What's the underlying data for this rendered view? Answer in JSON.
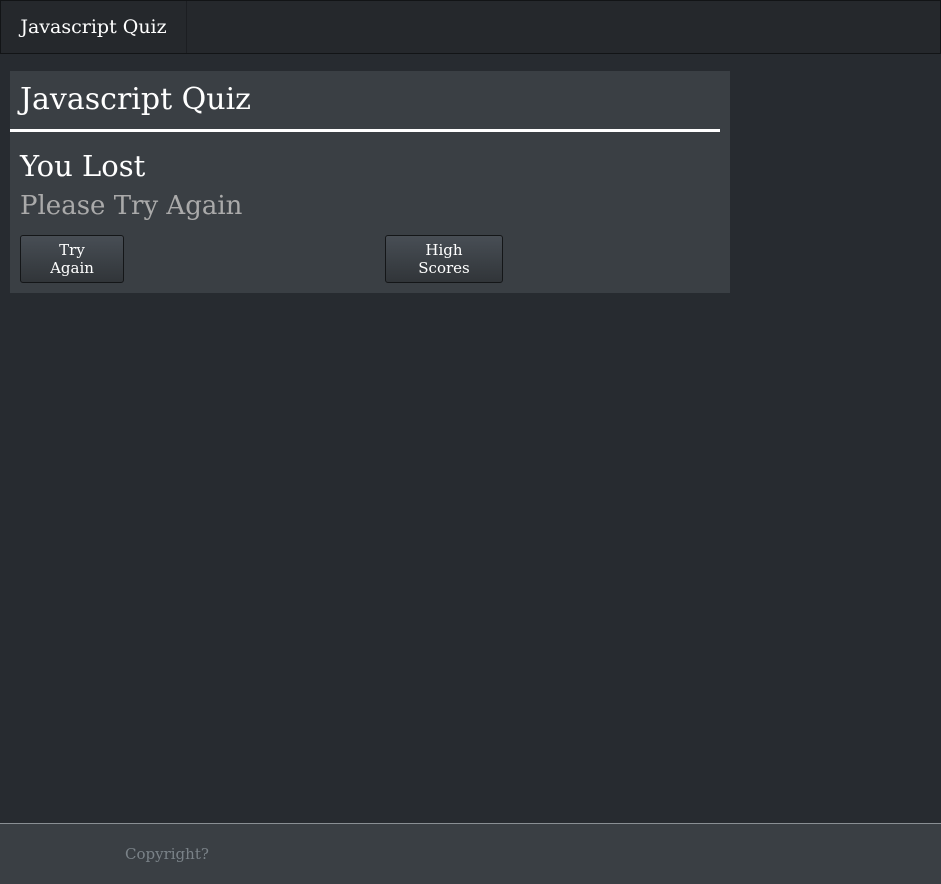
{
  "navbar": {
    "brand": "Javascript Quiz"
  },
  "card": {
    "title": "Javascript Quiz",
    "result_heading": "You Lost",
    "result_subtext": "Please Try Again",
    "buttons": {
      "try_again": "Try Again",
      "high_scores": "High Scores"
    }
  },
  "footer": {
    "text": "Copyright?"
  },
  "colors": {
    "background": "#272b30",
    "navbar": "#25282c",
    "card": "#3a3f44",
    "muted_text": "#aaaaaa",
    "footer_text": "#7a8288"
  }
}
